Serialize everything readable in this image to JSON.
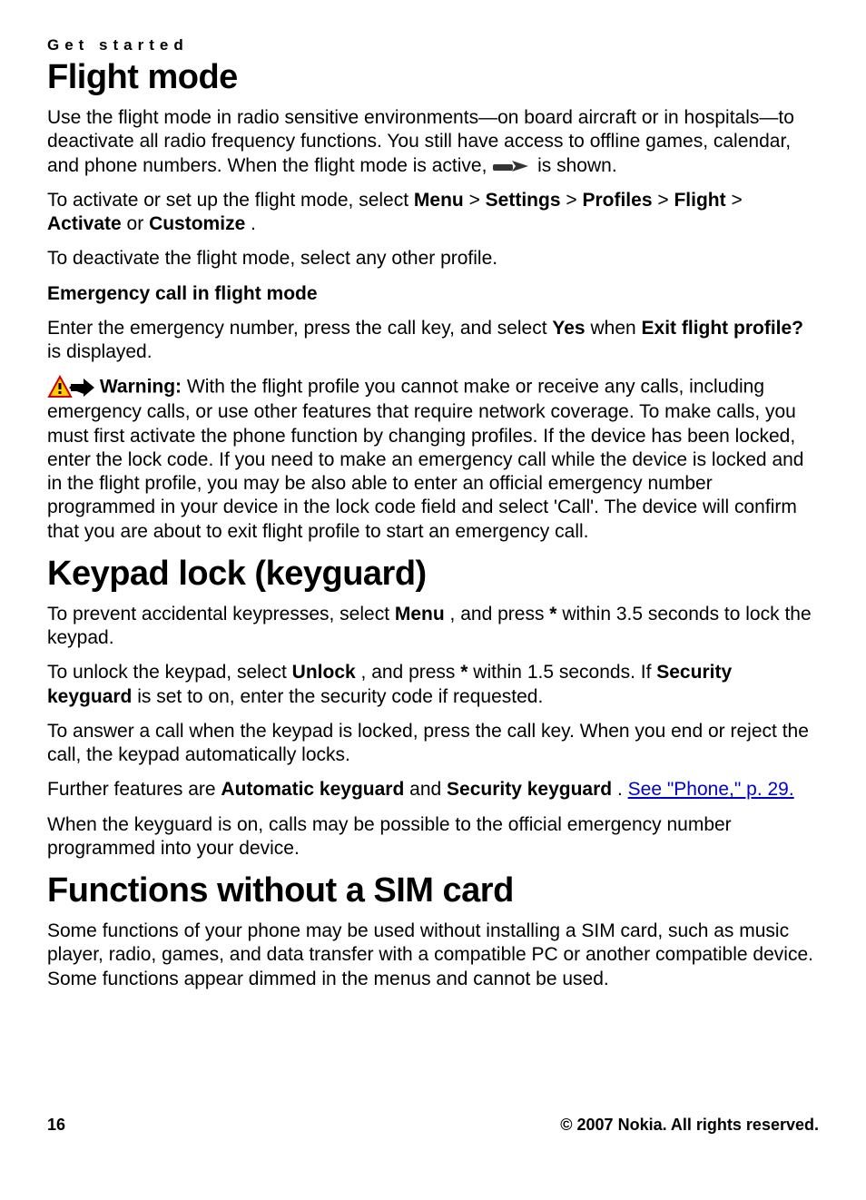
{
  "header": {
    "section_label": "Get started"
  },
  "flight": {
    "title": "Flight mode",
    "para1_a": "Use the flight mode in radio sensitive environments—on board aircraft or in hospitals—to deactivate all radio frequency functions. You still have access to offline games, calendar, and phone numbers. When the flight mode is active, ",
    "para1_b": " is shown.",
    "para2_pre": "To activate or set up the flight mode, select ",
    "menu": "Menu",
    "sep": " > ",
    "settings": "Settings",
    "profiles": "Profiles",
    "flight": "Flight",
    "activate": "Activate",
    "or": " or ",
    "customize": "Customize",
    "dot": ".",
    "para3": "To deactivate the flight mode, select any other profile.",
    "emerg_heading": "Emergency call in flight mode",
    "para4_pre": "Enter the emergency number, press the call key, and select ",
    "yes": "Yes",
    "when": " when ",
    "exit": "Exit flight profile?",
    "para4_post": " is displayed.",
    "warn_label": "Warning: ",
    "warn_body": " With the flight profile you cannot make or receive any calls, including emergency calls, or use other features that require network coverage. To make calls, you must first activate the phone function by changing profiles. If the device has been locked, enter the lock code. If you need to make an emergency call while the device is locked and in the flight profile, you may be also able to enter an official emergency number programmed in your device in the lock code field and select 'Call'. The device will confirm that you are about to exit flight profile to start an emergency call."
  },
  "keypad": {
    "title": "Keypad lock (keyguard)",
    "p1_a": "To prevent accidental keypresses, select ",
    "p1_menu": "Menu",
    "p1_b": ", and press ",
    "p1_star": "*",
    "p1_c": " within 3.5 seconds to lock the keypad.",
    "p2_a": "To unlock the keypad, select ",
    "p2_unlock": "Unlock",
    "p2_b": ", and press ",
    "p2_star": "*",
    "p2_c": " within 1.5 seconds. If ",
    "p2_sec": "Security keyguard",
    "p2_d": " is set to on, enter the security code if requested.",
    "p3": "To answer a call when the keypad is locked, press the call key. When you end or reject the call, the keypad automatically locks.",
    "p4_a": "Further features are ",
    "p4_auto": "Automatic keyguard",
    "p4_and": " and ",
    "p4_sec": "Security keyguard",
    "p4_dot": ". ",
    "p4_link": "See \"Phone,\" p. 29.",
    "p5": "When the keyguard is on, calls may be possible to the official emergency number programmed into your device."
  },
  "nosim": {
    "title": "Functions without a SIM card",
    "p1": "Some functions of your phone may be used without installing a SIM card, such as music player, radio, games, and data transfer with a compatible PC or another compatible device. Some functions appear dimmed in the menus and cannot be used."
  },
  "footer": {
    "page": "16",
    "copyright": "© 2007 Nokia. All rights reserved."
  }
}
